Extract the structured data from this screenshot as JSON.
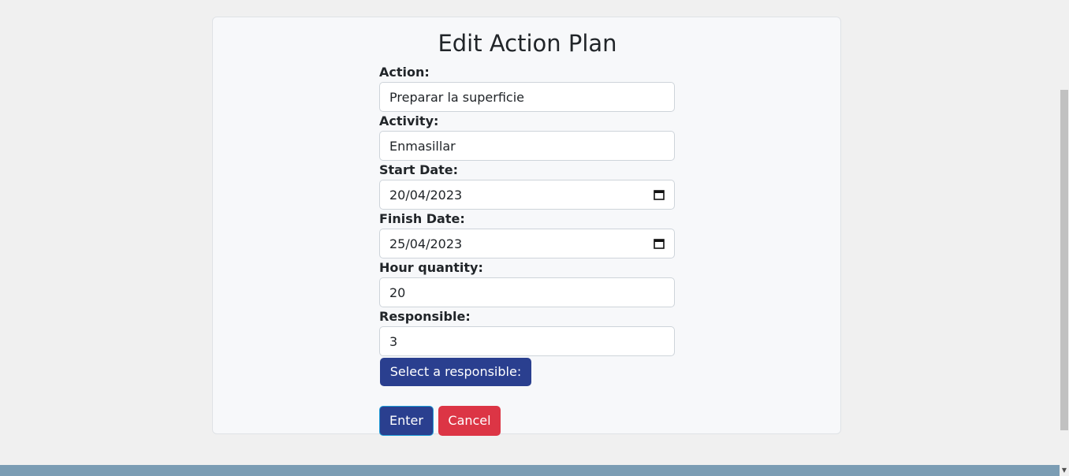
{
  "page": {
    "title": "Edit Action Plan"
  },
  "form": {
    "action": {
      "label": "Action:",
      "value": "Preparar la superficie"
    },
    "activity": {
      "label": "Activity:",
      "value": "Enmasillar"
    },
    "start_date": {
      "label": "Start Date:",
      "value": "20/04/2023"
    },
    "finish_date": {
      "label": "Finish Date:",
      "value": "25/04/2023"
    },
    "hour_quantity": {
      "label": "Hour quantity:",
      "value": "20"
    },
    "responsible": {
      "label": "Responsible:",
      "value": "3"
    }
  },
  "buttons": {
    "select_responsible": "Select a responsible:",
    "enter": "Enter",
    "cancel": "Cancel"
  },
  "icons": {
    "calendar": "calendar-icon",
    "scroll_down": "scroll-down-arrow-icon"
  },
  "colors": {
    "primary": "#2a3f8f",
    "danger": "#dc3545",
    "footer": "#7b9db4",
    "card_bg": "#f7f8fa",
    "page_bg": "#f0f0f0"
  }
}
